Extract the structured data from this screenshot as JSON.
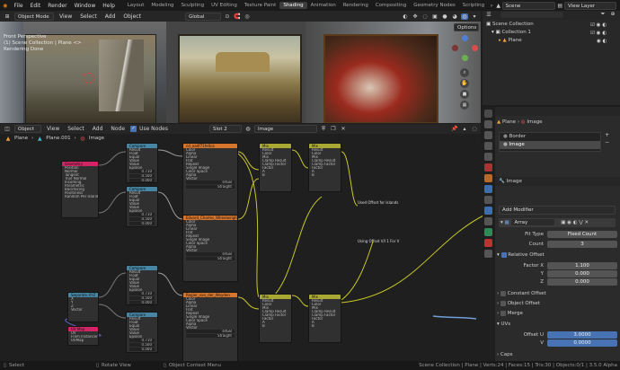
{
  "topbar": {
    "menus": [
      "File",
      "Edit",
      "Render",
      "Window",
      "Help"
    ],
    "tabs": [
      "Layout",
      "Modeling",
      "Sculpting",
      "UV Editing",
      "Texture Paint",
      "Shading",
      "Animation",
      "Rendering",
      "Compositing",
      "Geometry Nodes",
      "Scripting"
    ],
    "active_tab": "Shading",
    "scene": "Scene",
    "view_layer": "View Layer"
  },
  "viewport": {
    "mode": "Object Mode",
    "menus": [
      "View",
      "Select",
      "Add",
      "Object"
    ],
    "orientation": "Global",
    "options_label": "Options",
    "overlay_lines": [
      "Front Perspective",
      "(1) Scene Collection | Plane <>",
      "Rendering Done"
    ]
  },
  "node_editor": {
    "object_type": "Object",
    "menus": [
      "View",
      "Select",
      "Add",
      "Node"
    ],
    "use_nodes_label": "Use Nodes",
    "slot": "Slot 2",
    "material": "Image",
    "breadcrumb": [
      "Plane",
      "Plane.001",
      "Image"
    ],
    "annotations": [
      "Used Offset for Islands",
      "Using Offset V/I 1 For V"
    ],
    "nodes": [
      {
        "title": "Geometry",
        "color": "#d02666",
        "rows": [
          "Position",
          "Normal",
          "Tangent",
          "True Normal",
          "Incoming",
          "Parametric",
          "Backfacing",
          "Pointiness",
          "Random Per Island"
        ]
      },
      {
        "title": "Compare",
        "color": "#4686a4",
        "rows": [
          "Result",
          "Float",
          "Equal",
          "Value",
          "Value",
          "Epsilon"
        ],
        "values": [
          "0.710",
          "0.500",
          "0.000"
        ]
      },
      {
        "title": "Compare",
        "color": "#4686a4",
        "rows": [
          "Result",
          "Float",
          "Equal",
          "Value",
          "Value",
          "Epsilon"
        ],
        "values": [
          "0.710",
          "0.500",
          "0.000"
        ]
      },
      {
        "title": "cd_ea4f71fe0ca",
        "color": "#d6752c",
        "rows": [
          "Color",
          "Alpha",
          "Linear",
          "Flat",
          "Repeat",
          "Single Image",
          "Color Space",
          "Alpha",
          "Vector"
        ],
        "values": [
          "sRGB",
          "Straight"
        ]
      },
      {
        "title": "Edvard_Charles_Wheelwright",
        "color": "#d6752c",
        "rows": [
          "Color",
          "Alpha",
          "Linear",
          "Flat",
          "Repeat",
          "Single Image",
          "Color Space",
          "Alpha",
          "Vector"
        ],
        "values": [
          "sRGB",
          "Straight"
        ]
      },
      {
        "title": "Mix",
        "color": "#a8a832",
        "rows": [
          "Result",
          "Color",
          "Mix",
          "Clamp Result",
          "Clamp Factor",
          "Factor",
          "A",
          "B"
        ]
      },
      {
        "title": "Mix",
        "color": "#a8a832",
        "rows": [
          "Result",
          "Color",
          "Mix",
          "Clamp Result",
          "Clamp Factor",
          "Factor",
          "A",
          "B"
        ]
      },
      {
        "title": "Separate XYZ",
        "color": "#4686a4",
        "rows": [
          "X",
          "Y",
          "Z",
          "Vector"
        ]
      },
      {
        "title": "UV Map",
        "color": "#d02666",
        "rows": [
          "UV",
          "From Instancer",
          "UVMap"
        ]
      },
      {
        "title": "Compare",
        "color": "#4686a4",
        "rows": [
          "Result",
          "Float",
          "Equal",
          "Value",
          "Value",
          "Epsilon"
        ],
        "values": [
          "0.710",
          "0.500",
          "0.000"
        ]
      },
      {
        "title": "Compare",
        "color": "#4686a4",
        "rows": [
          "Result",
          "Float",
          "Equal",
          "Value",
          "Value",
          "Epsilon"
        ],
        "values": [
          "0.710",
          "0.500",
          "0.000"
        ]
      },
      {
        "title": "Rogier_van_der_Weyden",
        "color": "#d6752c",
        "rows": [
          "Color",
          "Alpha",
          "Linear",
          "Flat",
          "Repeat",
          "Single Image",
          "Color Space",
          "Alpha",
          "Vector"
        ],
        "values": [
          "sRGB",
          "Straight"
        ]
      },
      {
        "title": "Mix",
        "color": "#a8a832",
        "rows": [
          "Result",
          "Color",
          "Mix",
          "Clamp Result",
          "Clamp Factor",
          "Factor",
          "A",
          "B"
        ]
      },
      {
        "title": "Mix",
        "color": "#a8a832",
        "rows": [
          "Result",
          "Color",
          "Mix",
          "Clamp Result",
          "Clamp Factor",
          "Factor",
          "A",
          "B"
        ]
      }
    ]
  },
  "outliner": {
    "items": [
      {
        "label": "Scene Collection",
        "indent": 0
      },
      {
        "label": "Collection 1",
        "indent": 1
      },
      {
        "label": "Plane",
        "indent": 1
      }
    ]
  },
  "properties": {
    "object": "Plane",
    "material_name": "Image",
    "material_slots": [
      "Border",
      "Image"
    ],
    "modifier_header": "Image",
    "add_modifier": "Add Modifier",
    "modifier_name": "Array",
    "fit_type_label": "Fit Type",
    "fit_type_value": "Fixed Count",
    "count_label": "Count",
    "count_value": "3",
    "relative_offset_label": "Relative Offset",
    "factor_labels": [
      "Factor X",
      "Y",
      "Z"
    ],
    "factor_values": [
      "1.100",
      "0.000",
      "0.000"
    ],
    "collapsed_sections": [
      "Constant Offset",
      "Object Offset",
      "Merge"
    ],
    "uvs_label": "UVs",
    "offset_u_label": "Offset U",
    "offset_u_value": "3.0000",
    "offset_v_label": "V",
    "offset_v_value": "0.0000",
    "caps_label": "Caps"
  },
  "statusbar": {
    "left": [
      "Select",
      "Rotate View",
      "Object Context Menu"
    ],
    "right": "Scene Collection | Plane | Verts:24 | Faces:15 | Tris:30 | Objects:0/1 | 3.5.0 Alpha"
  },
  "colors": {
    "accent_blue": "#4772b3",
    "geometry_node": "#d02666",
    "converter_node": "#4686a4",
    "texture_node": "#d6752c",
    "mix_node": "#a8a832"
  }
}
